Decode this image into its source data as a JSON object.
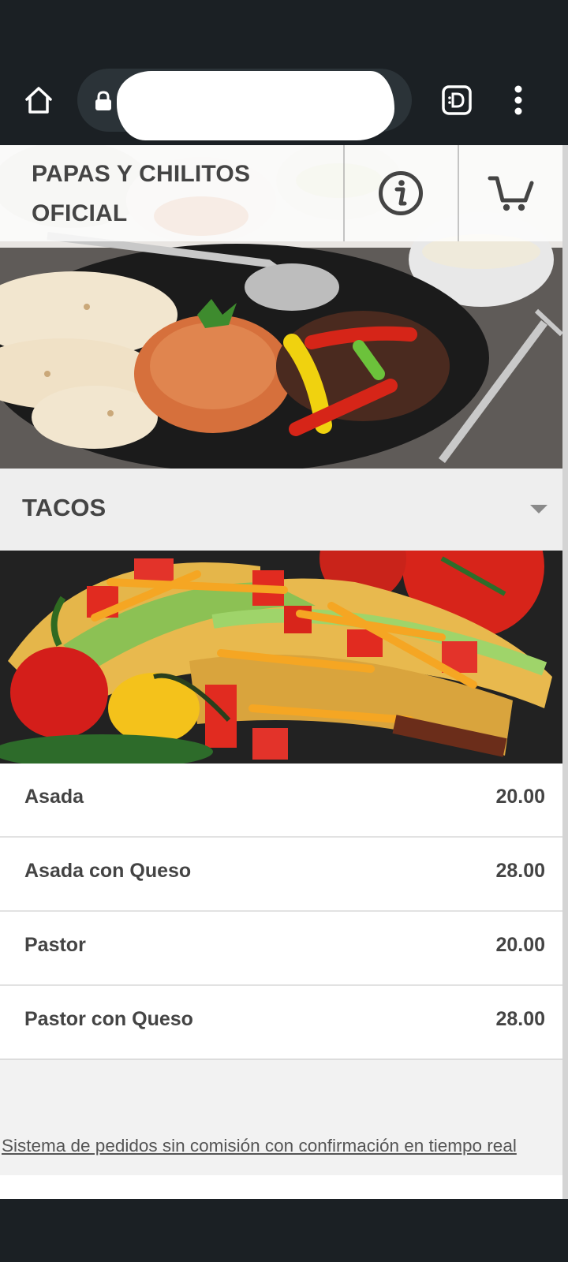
{
  "browser": {
    "home_icon": "home-icon",
    "lock_icon": "lock-icon",
    "tabs_icon": "tab-switcher-icon",
    "menu_icon": "more-vert-icon"
  },
  "header": {
    "brand": "PAPAS Y CHILITOS OFICIAL",
    "info_icon": "info-icon",
    "cart_icon": "cart-icon"
  },
  "category": {
    "title": "TACOS",
    "caret_icon": "caret-down-icon"
  },
  "items": [
    {
      "name": "Asada",
      "price": "20.00"
    },
    {
      "name": "Asada con Queso",
      "price": "28.00"
    },
    {
      "name": "Pastor",
      "price": "20.00"
    },
    {
      "name": "Pastor con Queso",
      "price": "28.00"
    }
  ],
  "footer": {
    "link": "Sistema de pedidos sin comisión con confirmación en tiempo real"
  },
  "colors": {
    "chrome_bg": "#1b2024",
    "page_bg": "#f2f2f2",
    "text": "#444444"
  }
}
